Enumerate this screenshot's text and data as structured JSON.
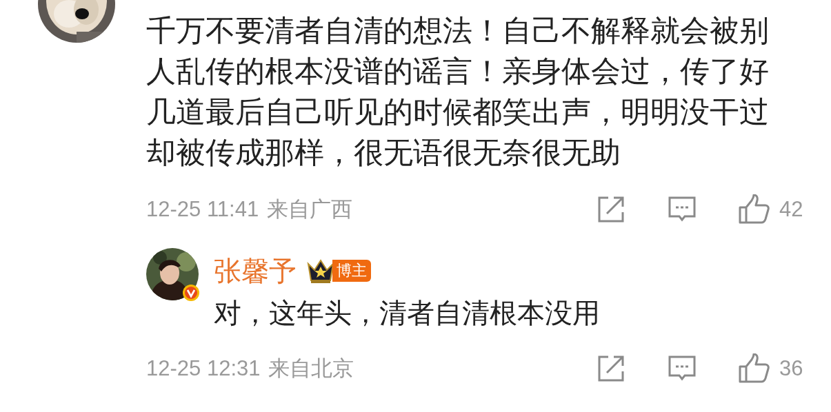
{
  "comment": {
    "text": "千万不要清者自清的想法！自己不解释就会被别人乱传的根本没谱的谣言！亲身体会过，传了好几道最后自己听见的时候都笑出声，明明没干过却被传成那样，很无语很无奈很无助",
    "time": "12-25 11:41",
    "location": "来自广西",
    "likes": "42",
    "reply": {
      "verified": true,
      "name": "张馨予",
      "badge": "博主",
      "text": "对，这年头，清者自清根本没用",
      "time": "12-25 12:31",
      "location": "来自北京",
      "likes": "36"
    }
  }
}
